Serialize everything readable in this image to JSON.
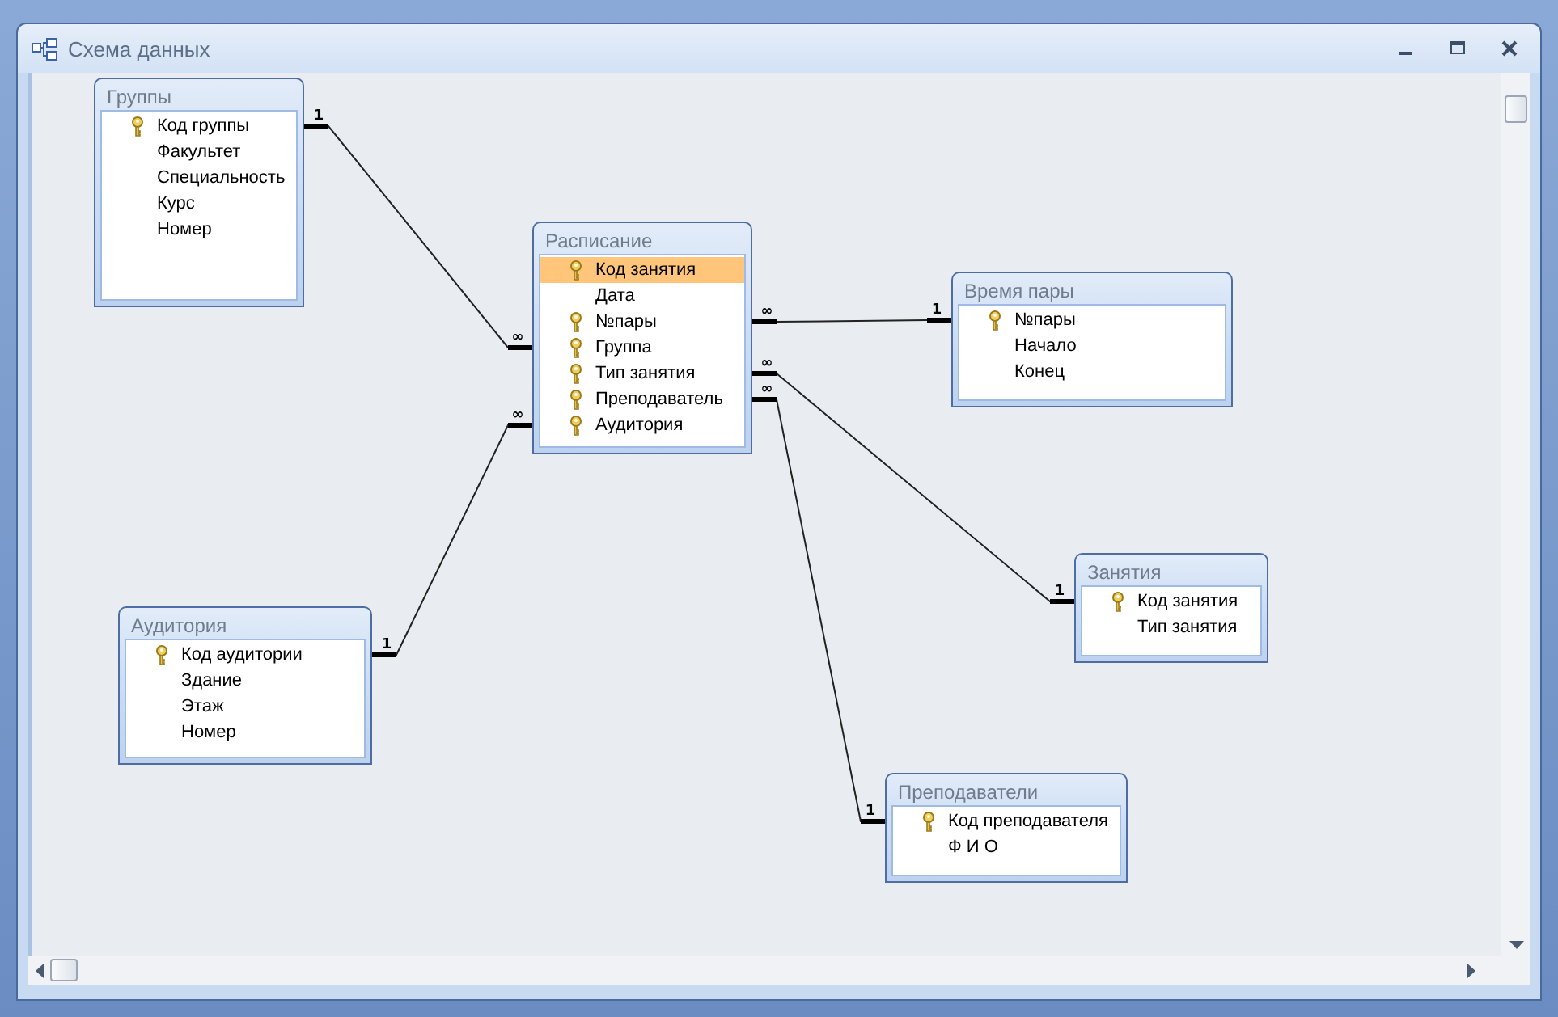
{
  "window": {
    "title": "Схема данных"
  },
  "tables": [
    {
      "name": "Группы",
      "fields": [
        {
          "name": "Код группы",
          "key": true,
          "selected": false
        },
        {
          "name": "Факультет",
          "key": false,
          "selected": false
        },
        {
          "name": "Специальность",
          "key": false,
          "selected": false
        },
        {
          "name": "Курс",
          "key": false,
          "selected": false
        },
        {
          "name": "Номер",
          "key": false,
          "selected": false
        }
      ]
    },
    {
      "name": "Расписание",
      "fields": [
        {
          "name": "Код занятия",
          "key": true,
          "selected": true
        },
        {
          "name": "Дата",
          "key": false,
          "selected": false
        },
        {
          "name": "№пары",
          "key": true,
          "selected": false
        },
        {
          "name": "Группа",
          "key": true,
          "selected": false
        },
        {
          "name": "Тип занятия",
          "key": true,
          "selected": false
        },
        {
          "name": "Преподаватель",
          "key": true,
          "selected": false
        },
        {
          "name": "Аудитория",
          "key": true,
          "selected": false
        }
      ]
    },
    {
      "name": "Время пары",
      "fields": [
        {
          "name": "№пары",
          "key": true,
          "selected": false
        },
        {
          "name": "Начало",
          "key": false,
          "selected": false
        },
        {
          "name": "Конец",
          "key": false,
          "selected": false
        }
      ]
    },
    {
      "name": "Занятия",
      "fields": [
        {
          "name": "Код занятия",
          "key": true,
          "selected": false
        },
        {
          "name": "Тип занятия",
          "key": false,
          "selected": false
        }
      ]
    },
    {
      "name": "Аудитория",
      "fields": [
        {
          "name": "Код аудитории",
          "key": true,
          "selected": false
        },
        {
          "name": "Здание",
          "key": false,
          "selected": false
        },
        {
          "name": "Этаж",
          "key": false,
          "selected": false
        },
        {
          "name": "Номер",
          "key": false,
          "selected": false
        }
      ]
    },
    {
      "name": "Преподаватели",
      "fields": [
        {
          "name": "Код преподавателя",
          "key": true,
          "selected": false
        },
        {
          "name": "Ф И О",
          "key": false,
          "selected": false
        }
      ]
    }
  ],
  "relationships": [
    {
      "one_label": "1",
      "many_label": "∞"
    },
    {
      "one_label": "1",
      "many_label": "∞"
    },
    {
      "one_label": "1",
      "many_label": "∞"
    },
    {
      "one_label": "1",
      "many_label": "∞"
    },
    {
      "one_label": "1",
      "many_label": "∞"
    }
  ]
}
